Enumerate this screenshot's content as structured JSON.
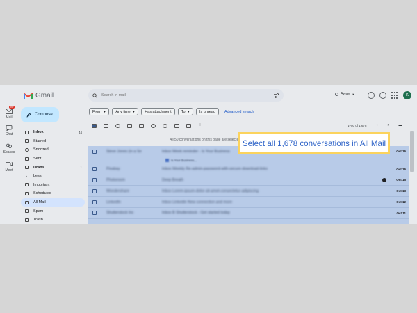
{
  "app": {
    "name": "Gmail"
  },
  "rail": [
    {
      "label": "Mail",
      "icon": "mail-icon",
      "badge": "99+"
    },
    {
      "label": "Chat",
      "icon": "chat-icon"
    },
    {
      "label": "Spaces",
      "icon": "spaces-icon"
    },
    {
      "label": "Meet",
      "icon": "meet-icon"
    }
  ],
  "search": {
    "placeholder": "Search in mail"
  },
  "status": {
    "label": "Away"
  },
  "account": {
    "initial": "K"
  },
  "compose": {
    "label": "Compose"
  },
  "nav": [
    {
      "label": "Inbox",
      "icon": "inbox-icon",
      "count": "44"
    },
    {
      "label": "Starred",
      "icon": "star-icon"
    },
    {
      "label": "Snoozed",
      "icon": "clock-icon"
    },
    {
      "label": "Sent",
      "icon": "send-icon"
    },
    {
      "label": "Drafts",
      "icon": "draft-icon",
      "count": "1"
    },
    {
      "label": "Less",
      "icon": "chevron-up-icon"
    },
    {
      "label": "Important",
      "icon": "important-icon"
    },
    {
      "label": "Scheduled",
      "icon": "scheduled-icon"
    },
    {
      "label": "All Mail",
      "icon": "all-mail-icon"
    },
    {
      "label": "Spam",
      "icon": "spam-icon"
    },
    {
      "label": "Trash",
      "icon": "trash-icon"
    }
  ],
  "filters": [
    "From",
    "Any time",
    "Has attachment",
    "To",
    "Is unread"
  ],
  "advanced_search": "Advanced search",
  "paging": {
    "range": "1–50 of 1,678"
  },
  "banner": "All 50 conversations on this page are selected.",
  "callout": {
    "text": "Select all 1,678 conversations in All Mail"
  },
  "rows": [
    {
      "sender": "Steve Jones (in a Se",
      "subject": "Inbox  Week reminder - Is Your Business",
      "date": "Oct 16",
      "attachment": "Is Your Business..."
    },
    {
      "sender": "Pixabay",
      "subject": "Inbox  Weekly Re-admin-password-with-secure-download-links",
      "date": "Oct 16"
    },
    {
      "sender": "Photoroom",
      "subject": "Deep Breath",
      "date": "Oct 15"
    },
    {
      "sender": "Wondershare",
      "subject": "Inbox  Lorem-ipsum-dolor-sit-amet-consectetur-adipiscing",
      "date": "Oct 13"
    },
    {
      "sender": "LinkedIn",
      "subject": "Inbox  Linkedin New connection and more",
      "date": "Oct 12"
    },
    {
      "sender": "Shutterstock Inc",
      "subject": "Inbox  B Shutterstock - Get started today",
      "date": "Oct 11"
    }
  ],
  "colors": {
    "accent": "#2f64c8",
    "highlight_border": "#fbd35d",
    "selected_row": "#b8cbe8"
  }
}
